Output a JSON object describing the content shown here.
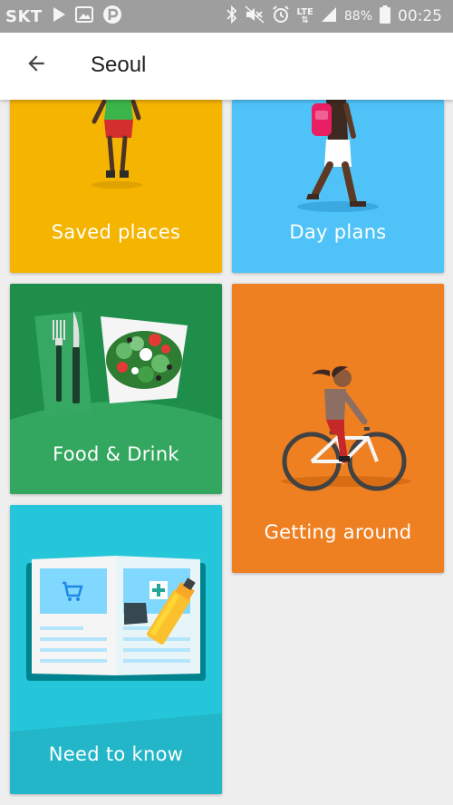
{
  "status_bar": {
    "carrier": "SKT",
    "network": "LTE",
    "battery": "88%",
    "time": "00:25",
    "icons": [
      "play-icon",
      "image-icon",
      "p-app-icon",
      "bluetooth-icon",
      "mute-icon",
      "alarm-icon",
      "signal-icon",
      "battery-icon"
    ]
  },
  "app_bar": {
    "back_icon": "arrow-back-icon",
    "title": "Seoul"
  },
  "cards": {
    "saved_places": {
      "label": "Saved places",
      "color": "#f4b400"
    },
    "day_plans": {
      "label": "Day plans",
      "color": "#4fc3f7"
    },
    "food_drink": {
      "label": "Food & Drink",
      "color": "#1e8e4a"
    },
    "getting_around": {
      "label": "Getting around",
      "color": "#ef8022"
    },
    "need_to_know": {
      "label": "Need to know",
      "color": "#26c6da"
    }
  }
}
